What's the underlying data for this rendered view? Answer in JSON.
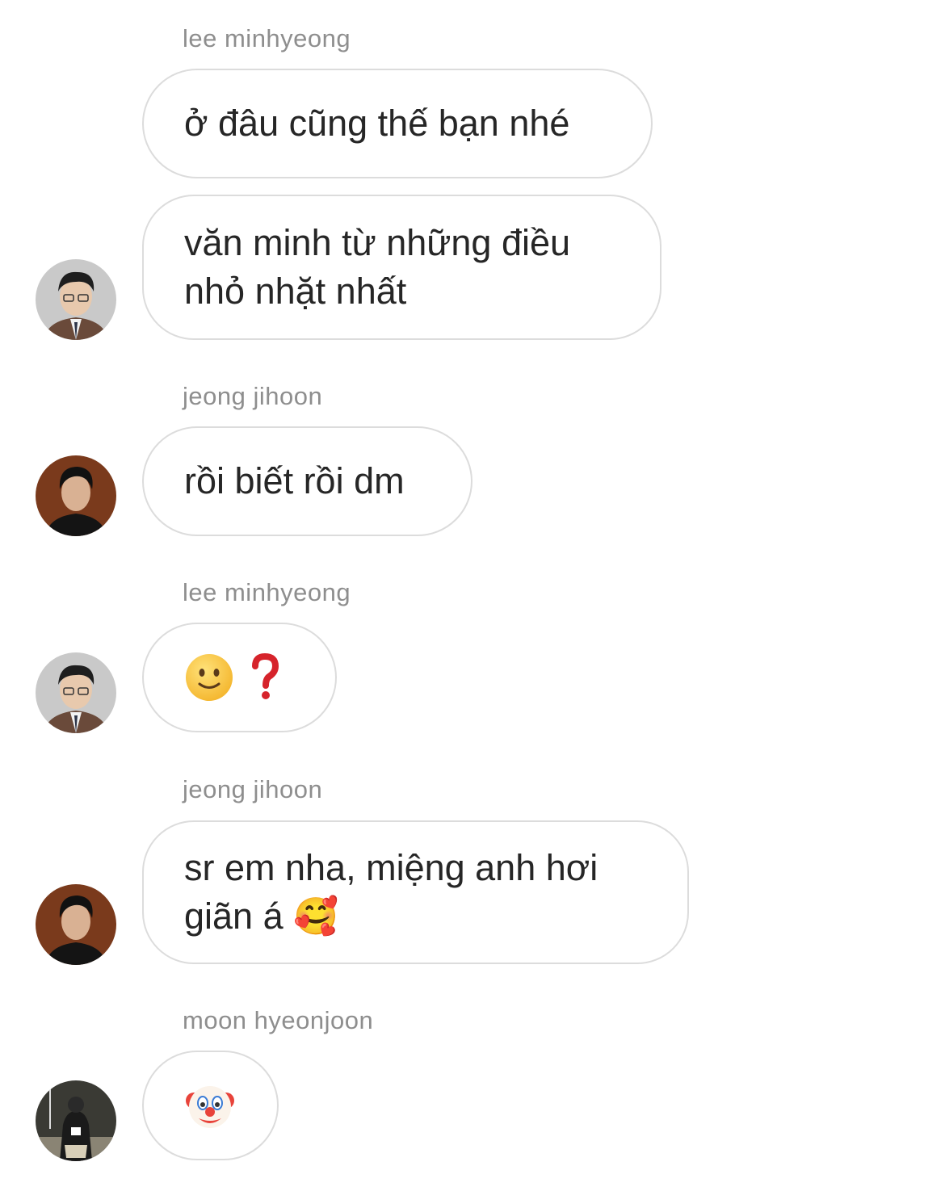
{
  "messages": [
    {
      "sender": "lee minhyeong",
      "bubbles": [
        "ở đâu cũng thế bạn nhé",
        "văn minh từ những điều\nnhỏ nhặt nhất"
      ],
      "avatar": "avatar-lee-minhyeong"
    },
    {
      "sender": "jeong jihoon",
      "bubbles": [
        "rồi biết rồi dm"
      ],
      "avatar": "avatar-jeong-jihoon"
    },
    {
      "sender": "lee minhyeong",
      "bubbles": [
        "🙂 ❓"
      ],
      "avatar": "avatar-lee-minhyeong"
    },
    {
      "sender": "jeong jihoon",
      "bubbles": [
        "sr em nha, miệng anh hơi\ngiãn á 🥰"
      ],
      "avatar": "avatar-jeong-jihoon"
    },
    {
      "sender": "moon hyeonjoon",
      "bubbles": [
        "🤡"
      ],
      "avatar": "avatar-moon-hyeonjoon"
    }
  ],
  "icons": {
    "slight_smile": "slightly-smiling-face-icon",
    "question": "red-question-mark-icon",
    "heart_face": "smiling-face-with-hearts-icon",
    "clown": "clown-face-icon"
  }
}
